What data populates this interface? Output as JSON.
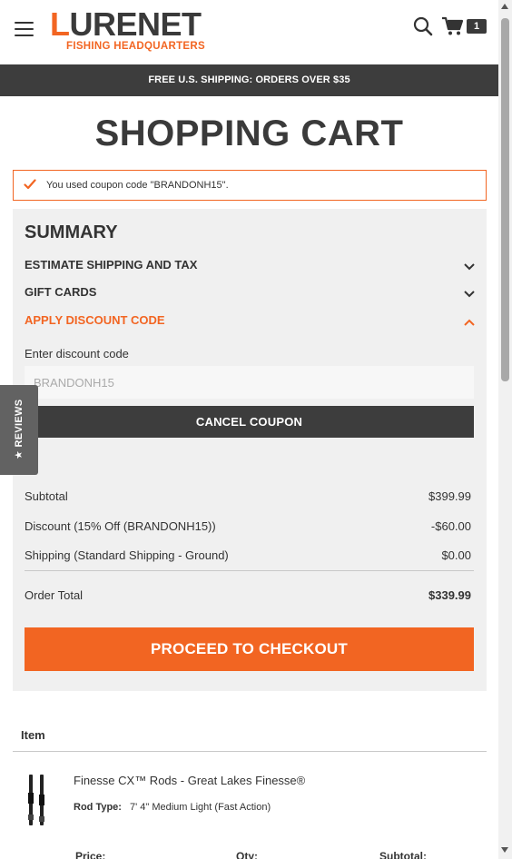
{
  "header": {
    "logo_main_first": "L",
    "logo_main_rest": "URENET",
    "logo_sub": "FISHING HEADQUARTERS",
    "cart_count": "1"
  },
  "banner": {
    "text": "FREE U.S. SHIPPING: ORDERS OVER $35"
  },
  "page": {
    "title": "SHOPPING CART"
  },
  "coupon_message": "You used coupon code \"BRANDONH15\".",
  "summary": {
    "title": "SUMMARY",
    "accordion": [
      {
        "label": "ESTIMATE SHIPPING AND TAX",
        "expanded": false
      },
      {
        "label": "GIFT CARDS",
        "expanded": false
      },
      {
        "label": "APPLY DISCOUNT CODE",
        "expanded": true
      }
    ],
    "discount_label": "Enter discount code",
    "discount_value": "BRANDONH15",
    "cancel_button": "CANCEL COUPON",
    "totals": {
      "subtotal_label": "Subtotal",
      "subtotal_value": "$399.99",
      "discount_label": "Discount (15% Off (BRANDONH15))",
      "discount_value": "-$60.00",
      "shipping_label": "Shipping (Standard Shipping - Ground)",
      "shipping_value": "$0.00",
      "order_total_label": "Order Total",
      "order_total_value": "$339.99"
    },
    "checkout_button": "PROCEED TO CHECKOUT"
  },
  "reviews_tab": "★ REVIEWS",
  "items": {
    "header": "Item",
    "product": {
      "name": "Finesse CX™ Rods - Great Lakes Finesse®",
      "option_key": "Rod Type:",
      "option_value": "7' 4\" Medium Light (Fast Action)"
    },
    "columns": {
      "price": "Price:",
      "qty": "Qty:",
      "subtotal": "Subtotal:"
    }
  },
  "colors": {
    "accent": "#f26522",
    "dark": "#3d3d3d",
    "panel": "#f0f0f0"
  }
}
